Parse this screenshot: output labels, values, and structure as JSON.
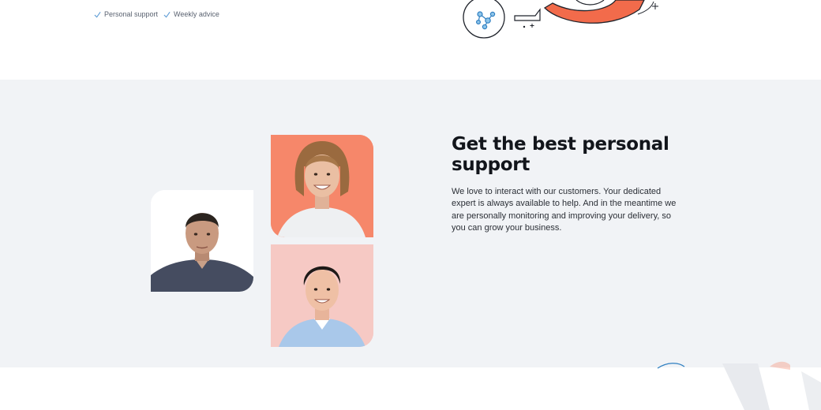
{
  "features": {
    "items": [
      {
        "label": "Personal support",
        "icon": "check-icon"
      },
      {
        "label": "Weekly advice",
        "icon": "check-icon"
      }
    ]
  },
  "illustration": {
    "icon": "network-nodes-icon",
    "accent": "#f26b4b"
  },
  "support": {
    "title": "Get the best personal support",
    "body": "We love to interact with our customers. Your dedicated expert is always available to help. And in the meantime we are personally monitoring and improving your delivery, so you can grow your business.",
    "photos": [
      {
        "name": "expert-photo-1",
        "bg": "#ffffff"
      },
      {
        "name": "expert-photo-2",
        "bg": "#f6876a"
      },
      {
        "name": "expert-photo-3",
        "bg": "#f6c9c4"
      }
    ]
  },
  "colors": {
    "section_bg": "#f1f3f6",
    "accent": "#f26b4b",
    "check": "#5b9bd5"
  }
}
